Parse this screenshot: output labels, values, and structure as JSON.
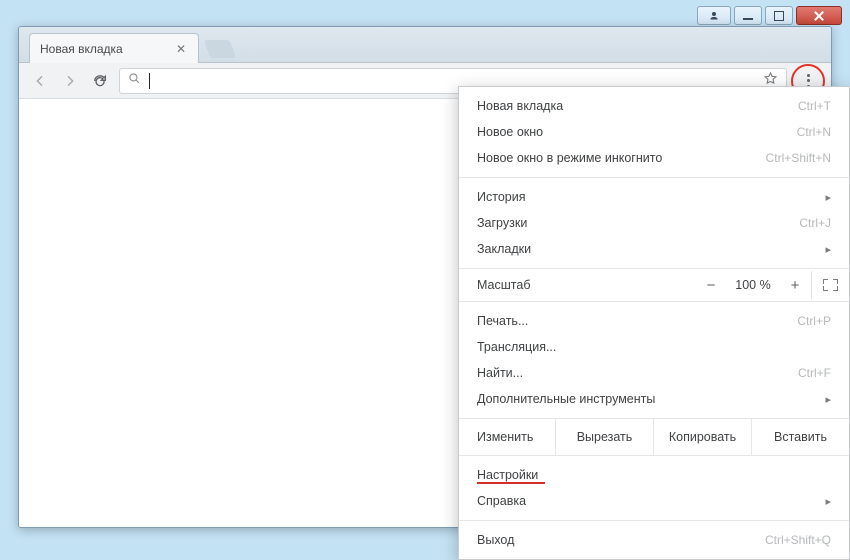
{
  "window": {
    "titlebar": {
      "profile_icon": "profile-icon",
      "minimize_icon": "minimize-icon",
      "maximize_icon": "maximize-icon",
      "close_icon": "close-icon"
    }
  },
  "tab": {
    "title": "Новая вкладка",
    "close_icon": "close-icon"
  },
  "toolbar": {
    "back_icon": "arrow-left-icon",
    "forward_icon": "arrow-right-icon",
    "reload_icon": "reload-icon",
    "search_icon": "search-icon",
    "address_value": "",
    "address_placeholder": "",
    "star_icon": "star-icon",
    "menu_icon": "kebab-menu-icon"
  },
  "menu": {
    "section1": [
      {
        "label": "Новая вкладка",
        "shortcut": "Ctrl+T"
      },
      {
        "label": "Новое окно",
        "shortcut": "Ctrl+N"
      },
      {
        "label": "Новое окно в режиме инкогнито",
        "shortcut": "Ctrl+Shift+N"
      }
    ],
    "section2": [
      {
        "label": "История",
        "submenu": true
      },
      {
        "label": "Загрузки",
        "shortcut": "Ctrl+J"
      },
      {
        "label": "Закладки",
        "submenu": true
      }
    ],
    "zoom": {
      "label": "Масштаб",
      "minus": "−",
      "value": "100 %",
      "plus": "+",
      "fullscreen_icon": "fullscreen-icon"
    },
    "section3": [
      {
        "label": "Печать...",
        "shortcut": "Ctrl+P"
      },
      {
        "label": "Трансляция..."
      },
      {
        "label": "Найти...",
        "shortcut": "Ctrl+F"
      },
      {
        "label": "Дополнительные инструменты",
        "submenu": true
      }
    ],
    "edit": {
      "label": "Изменить",
      "cut": "Вырезать",
      "copy": "Копировать",
      "paste": "Вставить"
    },
    "section4": [
      {
        "label": "Настройки",
        "highlight": true
      },
      {
        "label": "Справка",
        "submenu": true
      }
    ],
    "section5": [
      {
        "label": "Выход",
        "shortcut": "Ctrl+Shift+Q"
      }
    ]
  }
}
